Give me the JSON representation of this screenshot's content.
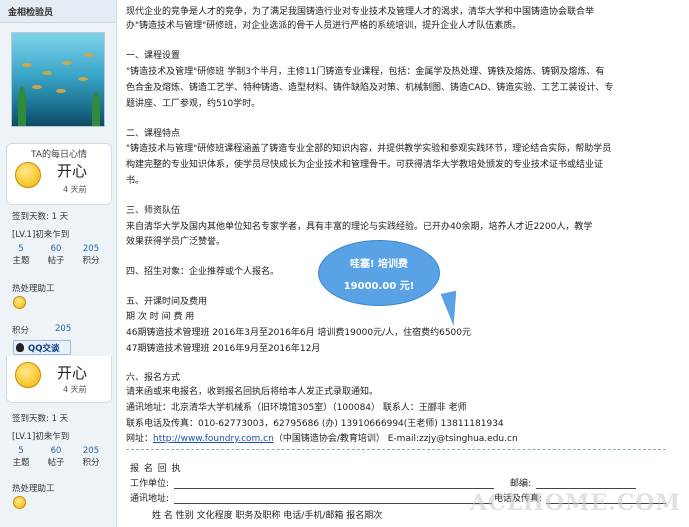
{
  "sidebar": {
    "header": "金相检验员",
    "mood1": {
      "title": "TA的每日心情",
      "word": "开心",
      "time": "4 天前"
    },
    "signin_days": "签到天数: 1 天",
    "level": "[LV.1]初来乍到",
    "stats": [
      {
        "value": "5",
        "label": "主题"
      },
      {
        "value": "60",
        "label": "帖子"
      },
      {
        "value": "205",
        "label": "积分"
      }
    ],
    "group": "热处理助工",
    "credit_label": "积分",
    "credit_value": "205",
    "qq_label": "QQ交谈",
    "mood2": {
      "word": "开心",
      "time": "4 天前"
    },
    "signin_days2": "签到天数: 1 天",
    "level2": "[LV.1]初来乍到",
    "stats2": [
      {
        "value": "5",
        "label": "主题"
      },
      {
        "value": "60",
        "label": "帖子"
      },
      {
        "value": "205",
        "label": "积分"
      }
    ],
    "group2": "热处理助工"
  },
  "content": {
    "intro1": "现代企业的竞争是人才的竞争，为了满足我国铸造行业对专业技术及管理人才的渴求，清华大学和中国铸造协会联合举",
    "intro2": "办\"铸造技术与管理\"研修班，对企业选派的骨干人员进行严格的系统培训，提升企业人才队伍素质。",
    "s1_title": "一、课程设置",
    "s1_l1": "\"铸造技术及管理\"研修班  学制3个半月，主修11门铸造专业课程，包括：金属学及热处理、铸铁及熔炼、铸钢及熔炼、有",
    "s1_l2": "色合金及熔炼、铸造工艺学、特种铸造、造型材料、铸件缺陷及对策、机械制图、铸造CAD、铸造实验、工艺工装设计、专",
    "s1_l3": "题讲座、工厂参观，约510学时。",
    "s2_title": "二、课程特点",
    "s2_l1": "\"铸造技术与管理\"研修班课程涵盖了铸造专业全部的知识内容，并提供教学实验和参观实践环节，理论结合实际，帮助学员",
    "s2_l2": "构建完整的专业知识体系，使学员尽快成长为企业技术和管理骨干。可获得清华大学教培处颁发的专业技术证书或结业证",
    "s2_l3": "书。",
    "s3_title": "三、师资队伍",
    "s3_l1": "    来自清华大学及国内其他单位知名专家学者，具有丰富的理论与实践经验。已开办40余期，培养人才近2200人，教学",
    "s3_l2": "效果获得学员广泛赞誉。",
    "s4": "四、招生对象：企业推荐或个人报名。",
    "s5_title": "五、开课时间及费用",
    "s5_header": "期  次        时    间        费  用",
    "s5_r1": "46期铸造技术管理班        2016年3月至2016年6月          培训费19000元/人，住宿费约6500元",
    "s5_r2": "47期铸造技术管理班        2016年9月至2016年12月",
    "s6_title": "六、报名方式",
    "s6_l1": "请来函或来电报名，收到报名回执后将给本人发正式录取通知。",
    "s6_l2": "通讯地址：北京清华大学机械系（旧环境馆305室）（100084）    联系人：王郦非 老师",
    "s6_l3": "联系电话及传真：010-62773003，62795686 (办)    13910666994(王老师)    13811181934",
    "s6_web_label": "网址：",
    "s6_web_link": "http://www.foundry.com.cn",
    "s6_web_rest": "（中国铸造协会/教育培训）        E-mail:zzjy@tsinghua.edu.cn",
    "form_title": "报 名 回 执",
    "form_unit": "工作单位:",
    "form_post": "邮编:",
    "form_addr": "通讯地址:",
    "form_tel": "电话及传真:",
    "form_cols": "姓  名        性别      文化程度      职务及职称      电话/手机/邮箱      报名期次"
  },
  "bubble": {
    "line1": "哇塞! 培训费",
    "line2": "19000.00 元!"
  },
  "watermark": "ACLHOME.COM"
}
